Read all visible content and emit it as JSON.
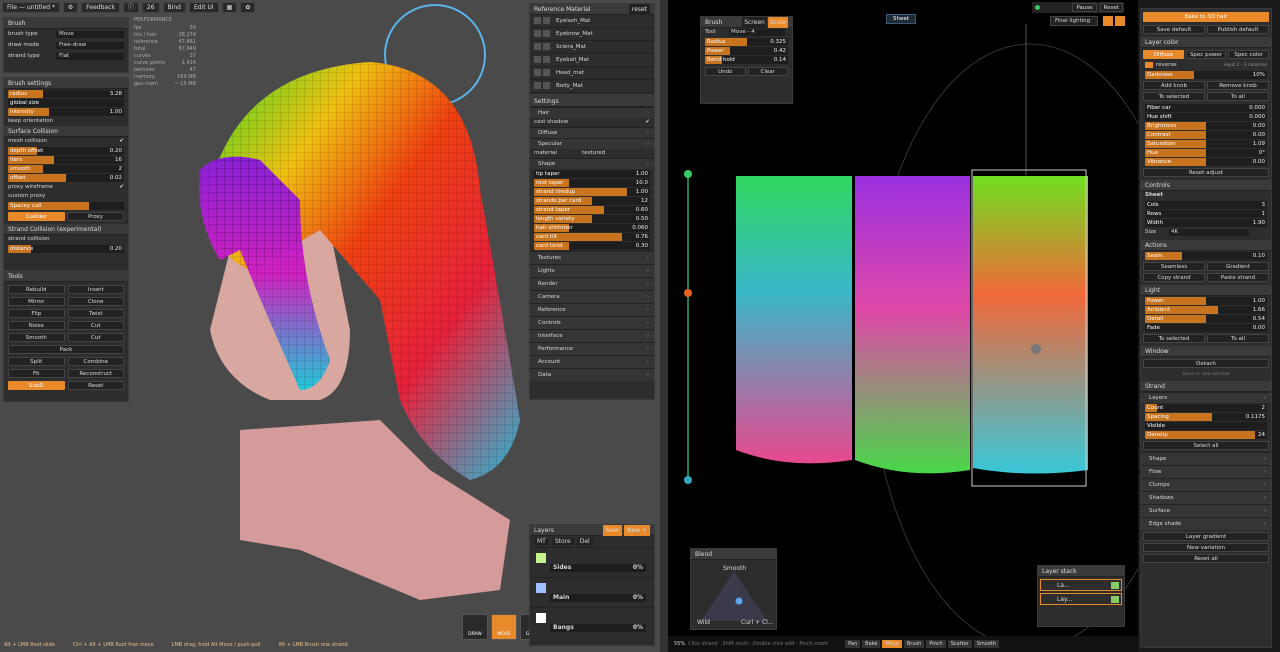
{
  "topbar": {
    "file": "File — untitled *",
    "feedback": "Feedback",
    "count": "26",
    "bind": "Bind",
    "editui": "Edit UI"
  },
  "brush": {
    "title": "Brush",
    "rows": [
      {
        "l": "brush type",
        "v": "Move"
      },
      {
        "l": "draw mode",
        "v": "Free-draw"
      },
      {
        "l": "strand type",
        "v": "Flat"
      }
    ]
  },
  "brush_settings": {
    "title": "Brush settings",
    "sliders": [
      {
        "l": "radius",
        "v": "3.28",
        "p": 0.3
      },
      {
        "l": "global size",
        "v": "",
        "p": 0
      },
      {
        "l": "intensity",
        "v": "1.00",
        "p": 0.35
      }
    ],
    "keep": "keep orientation"
  },
  "surface_collision": {
    "title": "Surface Collision",
    "mesh": "mesh collision",
    "sliders": [
      {
        "l": "depth offset",
        "v": "0.20",
        "p": 0.25
      },
      {
        "l": "iters",
        "v": "16",
        "p": 0.4
      },
      {
        "l": "smooth",
        "v": "2",
        "p": 0.3
      },
      {
        "l": "offset",
        "v": "0.02",
        "p": 0.5
      }
    ],
    "proxy": "proxy wireframe",
    "custom": "custom proxy",
    "spacey": "Spacey cull",
    "collider": "Collider",
    "proxy_btn": "Proxy"
  },
  "strand_collision": {
    "title": "Strand Collision (experimental)",
    "enable": "strand collision",
    "slider": {
      "l": "distance",
      "v": "0.20",
      "p": 0.2
    }
  },
  "tools": {
    "title": "Tools",
    "items": [
      [
        "Rebuild",
        "Insert"
      ],
      [
        "Mirror",
        "Clone"
      ],
      [
        "Flip",
        "Twist"
      ],
      [
        "Noise",
        "Cut"
      ],
      [
        "Smooth",
        "Cut"
      ]
    ],
    "pack": "Pack",
    "items2": [
      [
        "Split",
        "Combine"
      ],
      [
        "Fit",
        "Reconstruct"
      ]
    ],
    "subd": "SubD",
    "reset": "Reset"
  },
  "perf": {
    "title": "PERFORMANCE",
    "rows": [
      [
        "fps",
        "59"
      ],
      [
        "tris / hair",
        "28,174"
      ],
      [
        "reference",
        "47,461"
      ],
      [
        "total",
        "87,949"
      ],
      [
        "curves",
        "37"
      ],
      [
        "curve points",
        "1,414"
      ],
      [
        "textures",
        "47"
      ],
      [
        "memory",
        "169 MB"
      ],
      [
        "gpu mem",
        "~ 15 MB"
      ]
    ]
  },
  "refmat": {
    "title": "Reference Material",
    "reset": "reset",
    "items": [
      "Eyelash_Mat",
      "Eyebrow_Mat",
      "Sclera_Mat",
      "Eyeball_Mat",
      "Head_mat",
      "Body_Mat"
    ]
  },
  "settings": {
    "title": "Settings",
    "hair": "Hair",
    "cast": "cast shadow",
    "diffuse": "Diffuse",
    "specular": "Specular",
    "material": "material",
    "material_v": "textured",
    "shape": "Shape",
    "shape_sliders": [
      {
        "l": "tip taper",
        "v": "1.00",
        "p": 0.0
      },
      {
        "l": "root taper",
        "v": "10.0",
        "p": 0.3
      },
      {
        "l": "strand tiredup",
        "v": "1.00",
        "p": 0.8
      },
      {
        "l": "strands per card",
        "v": "12",
        "p": 0.5
      },
      {
        "l": "strand taper",
        "v": "0.60",
        "p": 0.6
      },
      {
        "l": "length variety",
        "v": "0.50",
        "p": 0.5
      },
      {
        "l": "hair shimmer",
        "v": "0.060",
        "p": 0.3
      },
      {
        "l": "card tilt",
        "v": "0.76",
        "p": 0.76
      },
      {
        "l": "card twist",
        "v": "0.30",
        "p": 0.3
      }
    ],
    "sections": [
      "Textures",
      "Lights",
      "Render",
      "Camera",
      "Reference",
      "Controls",
      "Interface",
      "Performance",
      "Account",
      "Data"
    ]
  },
  "layers_left": {
    "title": "Layers",
    "new": "New",
    "newp": "New +",
    "tools": [
      "MT",
      "Store",
      "Del"
    ],
    "items": [
      {
        "name": "Sides",
        "v": "0%",
        "c": "#c6f28e"
      },
      {
        "name": "Main",
        "v": "0%",
        "c": "#9ec0ff"
      },
      {
        "name": "Bangs",
        "v": "0%",
        "c": "#ffffff"
      }
    ]
  },
  "toolbar_bottom": [
    "DRAW",
    "MOVE",
    "GROW"
  ],
  "status_left": [
    "Alt + LMB Root slide",
    "Ctrl + Alt + LMB Root free move",
    "LMB drag, hold Alt Move / push-pull",
    "Alt + LMB Brush one strand"
  ],
  "right_top": {
    "pause": "Pause",
    "reset": "Reset",
    "lighting": "Final lighting",
    "sheet": "Sheet"
  },
  "brush_r": {
    "title": "Brush",
    "screen": "Screen",
    "scale": "Scale",
    "tool": "Tool",
    "tool_v": "Move - 4",
    "sliders": [
      {
        "l": "Radius",
        "v": "0.325",
        "p": 0.5
      },
      {
        "l": "Power",
        "v": "0.42",
        "p": 0.3
      },
      {
        "l": "Bend hold",
        "v": "0.14",
        "p": 0.2
      }
    ],
    "undo": "Undo",
    "clear": "Clear"
  },
  "mix": {
    "title": "Blend",
    "smooth": "Smooth",
    "wild": "Wild",
    "curl": "Curl + Cl..."
  },
  "layers_r": {
    "title": "Layer stack",
    "items": [
      "La...",
      "Lay..."
    ]
  },
  "right_status": {
    "zoom": "55%",
    "tip": "Click strand · Shift multi · Double click edit · Pinch zoom",
    "tabs": [
      "Pan",
      "Bake",
      "Move",
      "Brush",
      "Pinch",
      "Scatter",
      "Smooth"
    ]
  },
  "rp": {
    "bake": "Bake to 3D hair",
    "save_default": "Save default",
    "publish": "Publish default",
    "layer_color": "Layer color",
    "tabs": [
      "Diffuse",
      "Spec power",
      "Spec color"
    ],
    "mode": "reverse",
    "mode_v": "input 2 - 3 columns",
    "darkness": {
      "l": "Darkness",
      "v": "10%",
      "p": 0.4
    },
    "add_knob": "Add knob",
    "remove_knob": "Remove knob",
    "to_selected": "To selected",
    "to_all": "To all",
    "adj": [
      {
        "l": "Fiber car",
        "v": "0.000",
        "p": 0
      },
      {
        "l": "Hue shift",
        "v": "0.000",
        "p": 0.0
      },
      {
        "l": "Brightness",
        "v": "0.00",
        "p": 0.5
      },
      {
        "l": "Contrast",
        "v": "0.00",
        "p": 0.5
      },
      {
        "l": "Saturation",
        "v": "1.09",
        "p": 0.5
      },
      {
        "l": "Hue",
        "v": "0°",
        "p": 0.5
      },
      {
        "l": "Vibrance",
        "v": "0.00",
        "p": 0.5
      }
    ],
    "reset_adjust": "Reset adjust",
    "controls": "Controls",
    "sheet": "Sheet",
    "sheet_rows": [
      {
        "l": "Cols",
        "v": "3"
      },
      {
        "l": "Rows",
        "v": "1"
      },
      {
        "l": "Width",
        "v": "1.90"
      }
    ],
    "size": "Size",
    "size_v": "4K",
    "actions": "Actions",
    "seam": {
      "l": "Seam",
      "v": "0.10",
      "p": 0.3
    },
    "seamless": "Seamless",
    "gradient": "Gradient",
    "copy": "Copy strand",
    "paste": "Paste strand",
    "light": "Light",
    "light_s": [
      {
        "l": "Power",
        "v": "1.00",
        "p": 0.5
      },
      {
        "l": "Ambient",
        "v": "1.66",
        "p": 0.6
      },
      {
        "l": "Detail",
        "v": "0.54",
        "p": 0.5
      },
      {
        "l": "Fade",
        "v": "0.00",
        "p": 0
      }
    ],
    "window": "Window",
    "detach": "Detach",
    "detach_v": "Open in new window",
    "strand": "Strand",
    "layers": "Layers",
    "strand_s": [
      {
        "l": "Count",
        "v": "2",
        "p": 0.1
      },
      {
        "l": "Spacing",
        "v": "0.1175",
        "p": 0.55
      },
      {
        "l": "Visible",
        "v": "",
        "p": 0
      },
      {
        "l": "Density",
        "v": "24",
        "p": 0.9
      }
    ],
    "select_all": "Select all",
    "secs": [
      "Shape",
      "Flow",
      "Clumps",
      "Shadows",
      "Surface",
      "Edge shade"
    ],
    "layer_gradient": "Layer gradient",
    "new_variation": "New variation",
    "reset_all": "Reset all"
  },
  "colors": {
    "accent": "#e8892a",
    "panel": "#2d2d2d"
  }
}
